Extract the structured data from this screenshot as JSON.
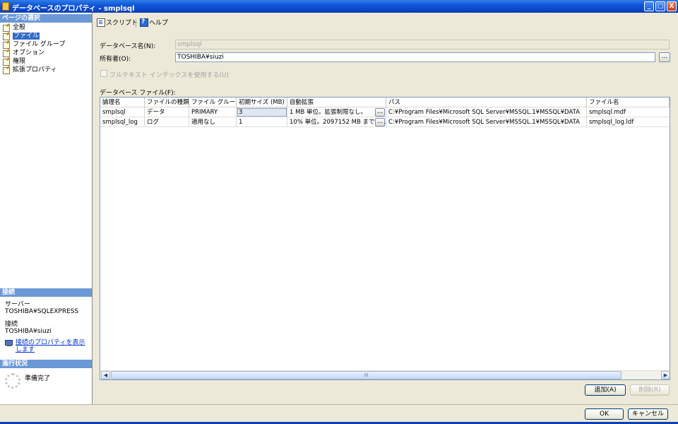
{
  "window": {
    "title": "データベースのプロパティ - smplsql"
  },
  "sidebar": {
    "pages_header": "ページの選択",
    "pages": [
      {
        "label": "全般",
        "selected": false
      },
      {
        "label": "ファイル",
        "selected": true
      },
      {
        "label": "ファイル グループ",
        "selected": false
      },
      {
        "label": "オプション",
        "selected": false
      },
      {
        "label": "権限",
        "selected": false
      },
      {
        "label": "拡張プロパティ",
        "selected": false
      }
    ],
    "connection_header": "接続",
    "server_label": "サーバー",
    "server_value": "TOSHIBA¥SQLEXPRESS",
    "connection_label": "接続",
    "connection_value": "TOSHIBA¥siuzi",
    "connection_link": "接続のプロパティを表示します",
    "progress_header": "進行状況",
    "progress_text": "準備完了"
  },
  "toolbar": {
    "script_label": "スクリプト",
    "script_arrow": "▾",
    "help_label": "ヘルプ"
  },
  "form": {
    "db_name_label": "データベース名(N):",
    "db_name_value": "smplsql",
    "owner_label": "所有者(O):",
    "owner_value": "TOSHIBA¥siuzi",
    "owner_browse": "...",
    "fulltext_label": "フルテキスト インデックスを使用する(U)",
    "fulltext_checked": false,
    "files_label": "データベース ファイル(F):"
  },
  "files_table": {
    "columns": [
      "論理名",
      "ファイルの種類",
      "ファイル グループ",
      "初期サイズ (MB)",
      "自動拡張",
      "パス",
      "ファイル名"
    ],
    "rows": [
      [
        "smplsql",
        "データ",
        "PRIMARY",
        "3",
        "1 MB 単位。拡張制限なし。",
        "C:¥Program Files¥Microsoft SQL Server¥MSSQL.1¥MSSQL¥DATA",
        "smplsql.mdf"
      ],
      [
        "smplsql_log",
        "ログ",
        "適用なし",
        "1",
        "10% 単位。2097152 MB までに...",
        "C:¥Program Files¥Microsoft SQL Server¥MSSQL.1¥MSSQL¥DATA",
        "smplsql_log.ldf"
      ]
    ],
    "cell_button": "...",
    "scroll_left": "◀",
    "scroll_right": "▶",
    "scroll_grip": "III"
  },
  "buttons": {
    "add": "追加(A)",
    "remove": "削除(R)",
    "ok": "OK",
    "cancel": "キャンセル"
  },
  "titlebar_buttons": {
    "minimize": "_",
    "maximize": "□",
    "close": "X"
  }
}
